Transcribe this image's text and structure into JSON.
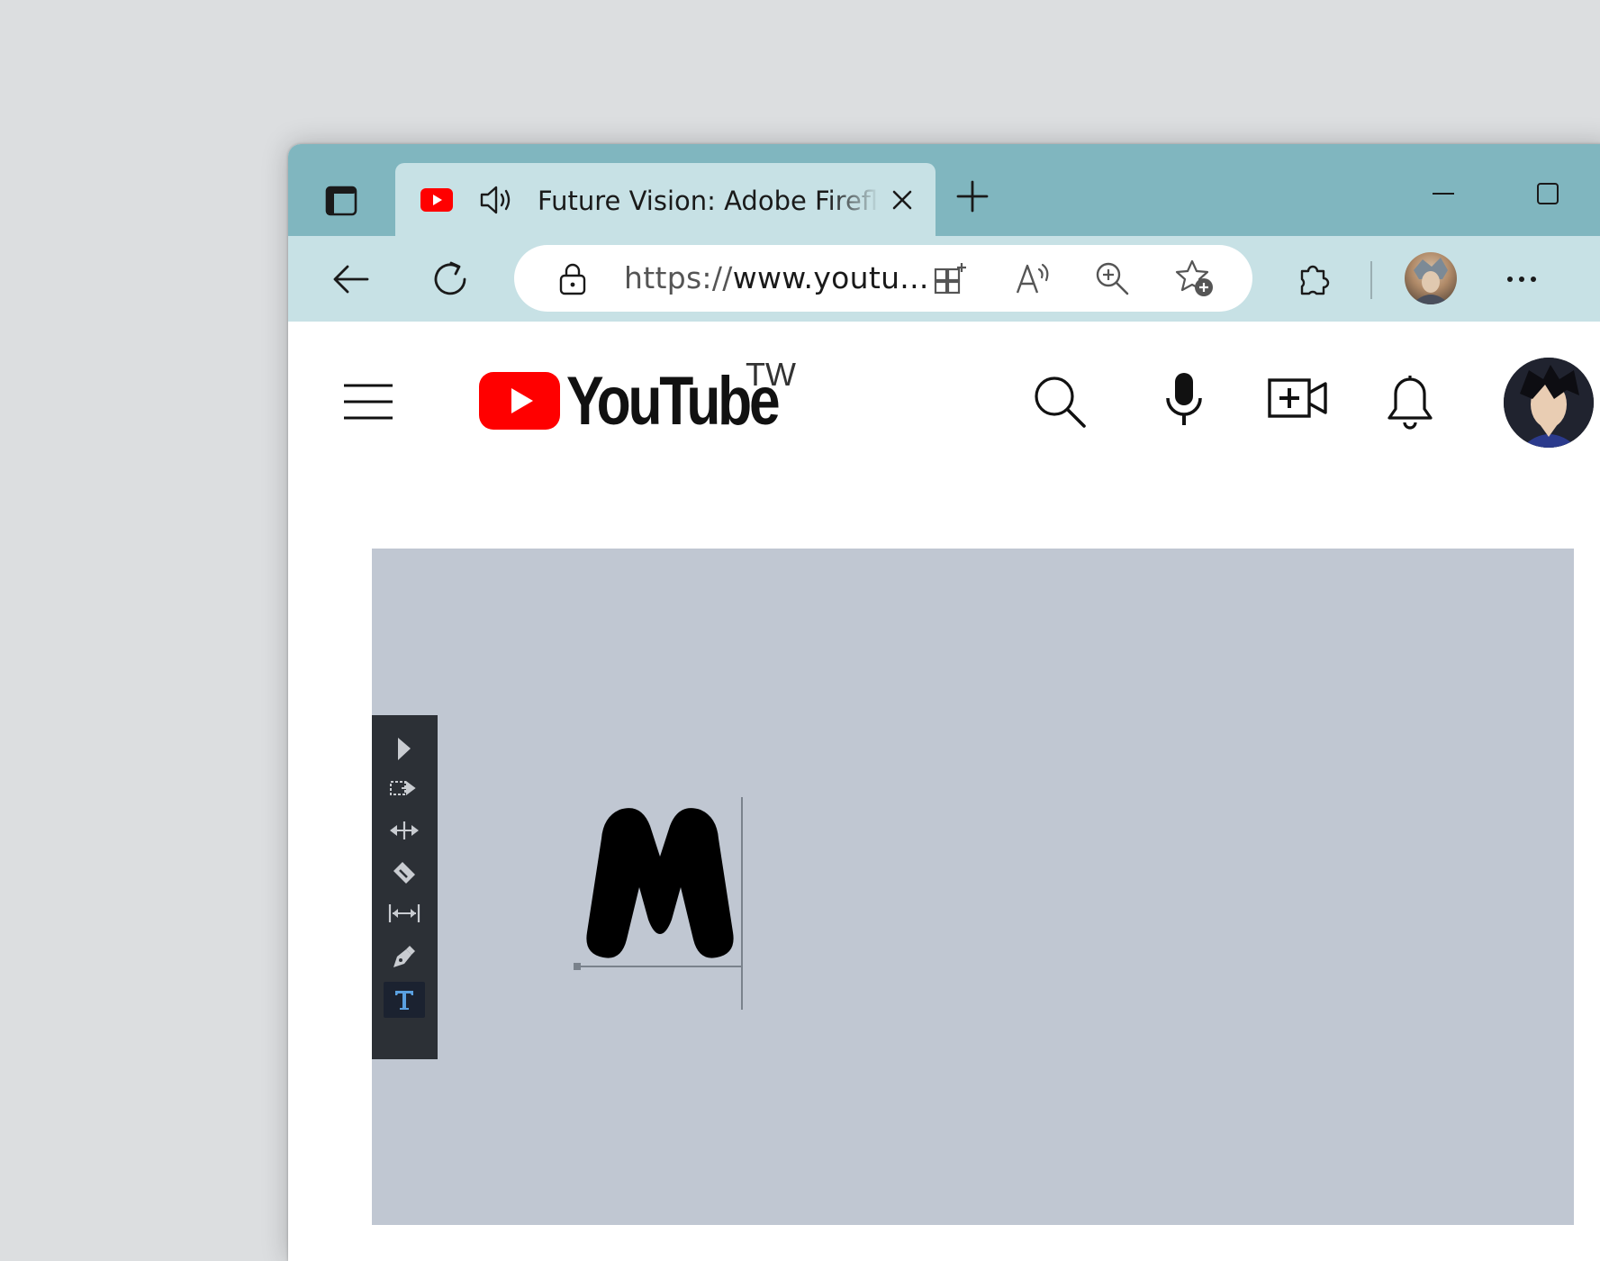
{
  "browser": {
    "tab": {
      "title": "Future Vision: Adobe Firefly"
    },
    "address": {
      "scheme": "https://",
      "host": "www.youtu..."
    },
    "colors": {
      "titlebar": "#80b6bf",
      "toolbar": "#c7e1e5"
    },
    "icons": [
      "tab-actions-icon",
      "youtube-favicon",
      "audio-icon",
      "close-icon",
      "plus-icon",
      "minimize-icon",
      "maximize-icon",
      "back-arrow-icon",
      "reload-icon",
      "lock-icon",
      "apps-icon",
      "read-aloud-icon",
      "zoom-icon",
      "add-favorite-icon",
      "extensions-icon",
      "more-icon"
    ]
  },
  "youtube": {
    "logo_text": "YouTube",
    "region": "TW",
    "colors": {
      "brand_red": "#ff0000"
    },
    "icons": [
      "hamburger-menu-icon",
      "search-icon",
      "microphone-icon",
      "create-video-icon",
      "bell-icon"
    ]
  },
  "video": {
    "background_color": "#c0c7d2",
    "canvas_text": "M",
    "tools": [
      "selection-tool-icon",
      "direct-selection-tool-icon",
      "move-tool-icon",
      "knife-tool-icon",
      "measure-tool-icon",
      "pen-tool-icon",
      "type-tool-icon"
    ],
    "active_tool": "type-tool-icon",
    "active_tool_color": "#5aa0e0"
  }
}
